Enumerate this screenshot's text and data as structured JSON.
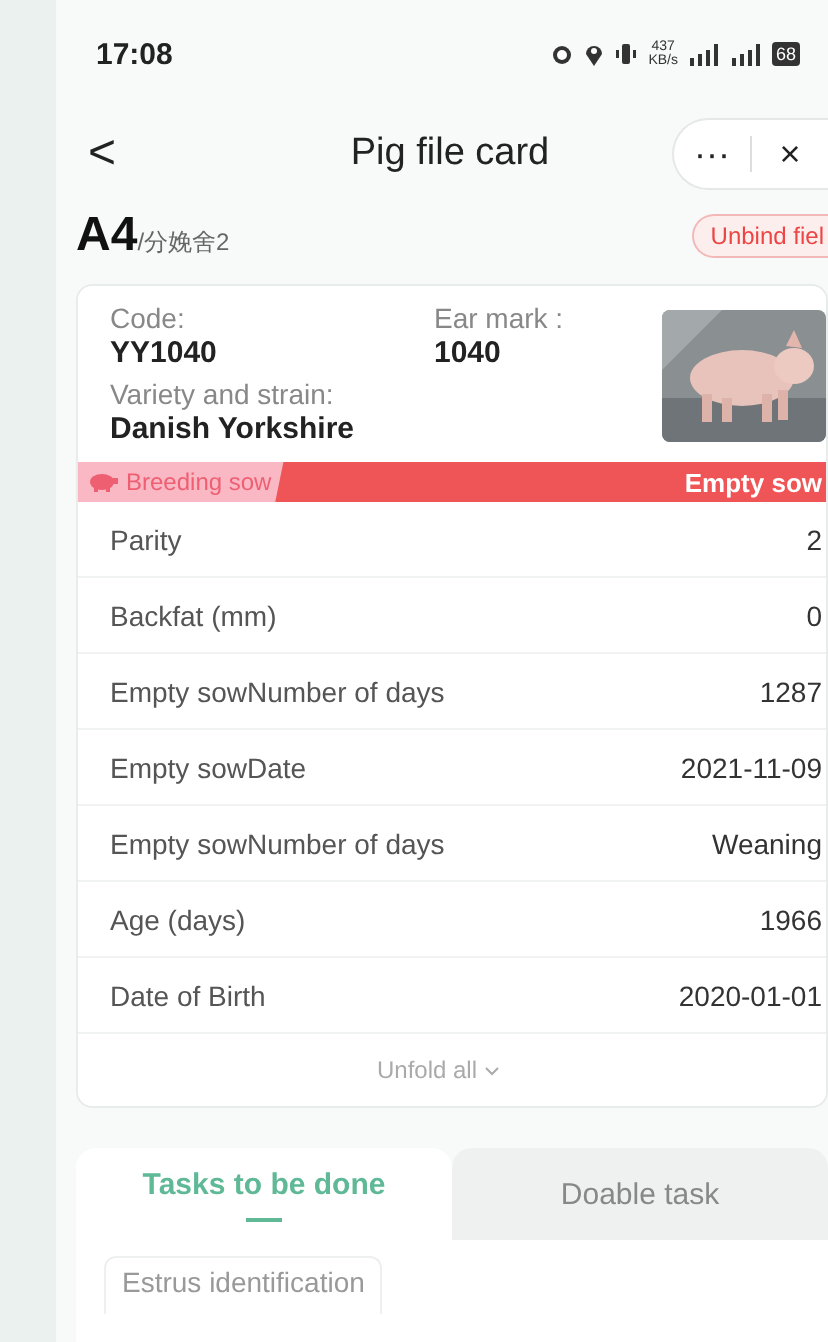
{
  "status_bar": {
    "time": "17:08",
    "speed": "437",
    "speed_unit": "KB/s",
    "battery": "68"
  },
  "nav": {
    "back": "<",
    "title": "Pig file card",
    "more": "···",
    "close": "×"
  },
  "header": {
    "pen": "A4",
    "house": "/分娩舍2",
    "unbind": "Unbind fiel"
  },
  "card": {
    "fields": [
      {
        "label": "Code:",
        "value": "YY1040"
      },
      {
        "label": "Ear mark :",
        "value": "1040"
      },
      {
        "label": "Variety and strain:",
        "value": "Danish Yorkshire"
      }
    ],
    "category": "Breeding sow",
    "status": "Empty sow",
    "rows": [
      {
        "label": "Parity",
        "value": "2"
      },
      {
        "label": "Backfat (mm)",
        "value": "0"
      },
      {
        "label": "Empty sowNumber of days",
        "value": "1287"
      },
      {
        "label": "Empty sowDate",
        "value": "2021-11-09"
      },
      {
        "label": "Empty sowNumber of days",
        "value": "Weaning"
      },
      {
        "label": "Age (days)",
        "value": "1966"
      },
      {
        "label": "Date of Birth",
        "value": "2020-01-01"
      }
    ],
    "unfold": "Unfold all"
  },
  "tabs": [
    {
      "label": "Tasks to be done",
      "selected": true
    },
    {
      "label": "Doable task",
      "selected": false
    }
  ],
  "task": "Estrus identification"
}
